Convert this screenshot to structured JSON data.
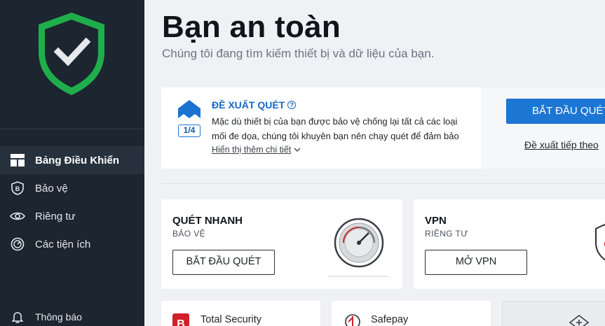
{
  "colors": {
    "sidebar_bg": "#1c2530",
    "accent_blue": "#1c76d4",
    "shield_green": "#1fae4b",
    "brand_red": "#d11f2b"
  },
  "sidebar": {
    "logo_icon": "shield-check-icon",
    "items": [
      {
        "label": "Bảng Điều Khiển",
        "icon": "dashboard-icon",
        "active": true
      },
      {
        "label": "Bảo vệ",
        "icon": "protection-shield-icon",
        "active": false
      },
      {
        "label": "Riêng tư",
        "icon": "eye-icon",
        "active": false
      },
      {
        "label": "Các tiện ích",
        "icon": "gauge-icon",
        "active": false
      }
    ],
    "notifications": {
      "label": "Thông báo",
      "icon": "bell-icon"
    }
  },
  "header": {
    "title": "Bạn an toàn",
    "subtitle": "Chúng tôi đang tìm kiếm thiết bị và dữ liệu của bạn."
  },
  "recommendation": {
    "badge": "1/4",
    "title": "ĐỀ XUẤT QUÉT",
    "description": "Mặc dù thiết bị của bạn được bảo vệ chống lại tất cả các loại mối đe dọa, chúng tôi khuyên bạn nên chạy quét để đảm bảo",
    "more_label": "Hiển thị thêm chi tiết",
    "primary_button": "BẮT ĐẦU QUÉT",
    "next_link": "Đề xuất tiếp theo"
  },
  "cards": [
    {
      "title": "QUÉT NHANH",
      "subtitle": "BẢO VỆ",
      "button": "BẮT ĐẦU QUÉT",
      "icon": "scan-gauge-icon"
    },
    {
      "title": "VPN",
      "subtitle": "RIÊNG TƯ",
      "button": "MỞ VPN",
      "icon": "vpn-shield-icon"
    }
  ],
  "mini_cards": [
    {
      "label": "Total Security",
      "icon": "bitdefender-b-icon"
    },
    {
      "label": "Safepay",
      "icon": "safepay-icon"
    },
    {
      "label": "",
      "icon": "add-icon"
    }
  ]
}
